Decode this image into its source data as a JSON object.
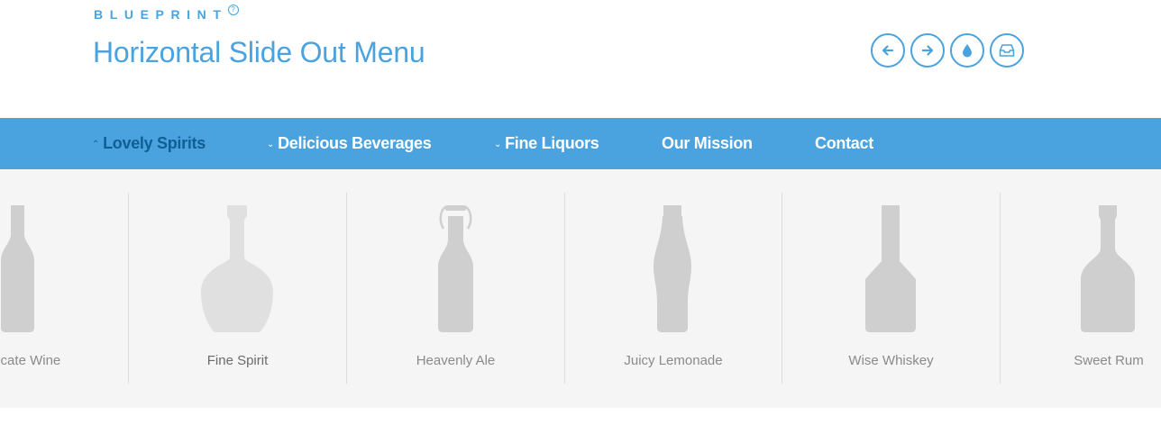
{
  "header": {
    "brand": "BLUEPRINT",
    "brand_help": "?",
    "title": "Horizontal Slide Out Menu",
    "icons": [
      "arrow-left-icon",
      "arrow-right-icon",
      "drop-icon",
      "inbox-icon"
    ]
  },
  "nav": {
    "items": [
      {
        "label": "Lovely Spirits",
        "chevron": "^",
        "active": true
      },
      {
        "label": "Delicious Beverages",
        "chevron": "v"
      },
      {
        "label": "Fine Liquors",
        "chevron": "v"
      },
      {
        "label": "Our Mission"
      },
      {
        "label": "Contact"
      }
    ]
  },
  "panel": {
    "products": [
      {
        "label": "Delicate Wine"
      },
      {
        "label": "Fine Spirit"
      },
      {
        "label": "Heavenly Ale"
      },
      {
        "label": "Juicy Lemonade"
      },
      {
        "label": "Wise Whiskey"
      },
      {
        "label": "Sweet Rum"
      }
    ]
  },
  "colors": {
    "accent": "#4aa3df",
    "active_nav": "#0f5f94",
    "bottle": "#cfcfcf",
    "bottle_light": "#e0e0e0",
    "panel_bg": "#f5f5f5"
  }
}
